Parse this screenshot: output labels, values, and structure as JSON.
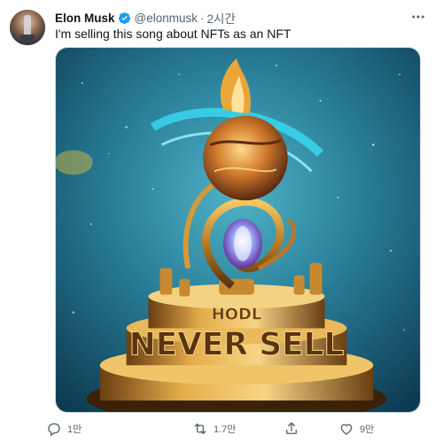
{
  "tweet": {
    "author_name": "Elon Musk",
    "handle": "@elonmusk",
    "separator": "·",
    "timestamp": "2시간",
    "text": "I'm selling this song about NFTs as an NFT",
    "media_alt": "NFT video still: golden rotating trophy sculpture with planet, reading HODL and NEVER SELL",
    "media_letters_upper": "HODL",
    "media_letters_lower": "NEVER SELL",
    "actions": {
      "reply_count": "1만",
      "retweet_count": "1.7만",
      "like_count": "9만"
    }
  },
  "icons": {
    "verified": "verified-badge-icon",
    "more": "more-options-icon",
    "reply": "reply-icon",
    "retweet": "retweet-icon",
    "like": "like-icon",
    "share": "share-icon"
  },
  "colors": {
    "verified_blue": "#1d9bf0",
    "text_primary": "#0f1419",
    "text_secondary": "#536471",
    "media_teal": "#2f8fa6",
    "media_gold": "#c98a2a"
  }
}
